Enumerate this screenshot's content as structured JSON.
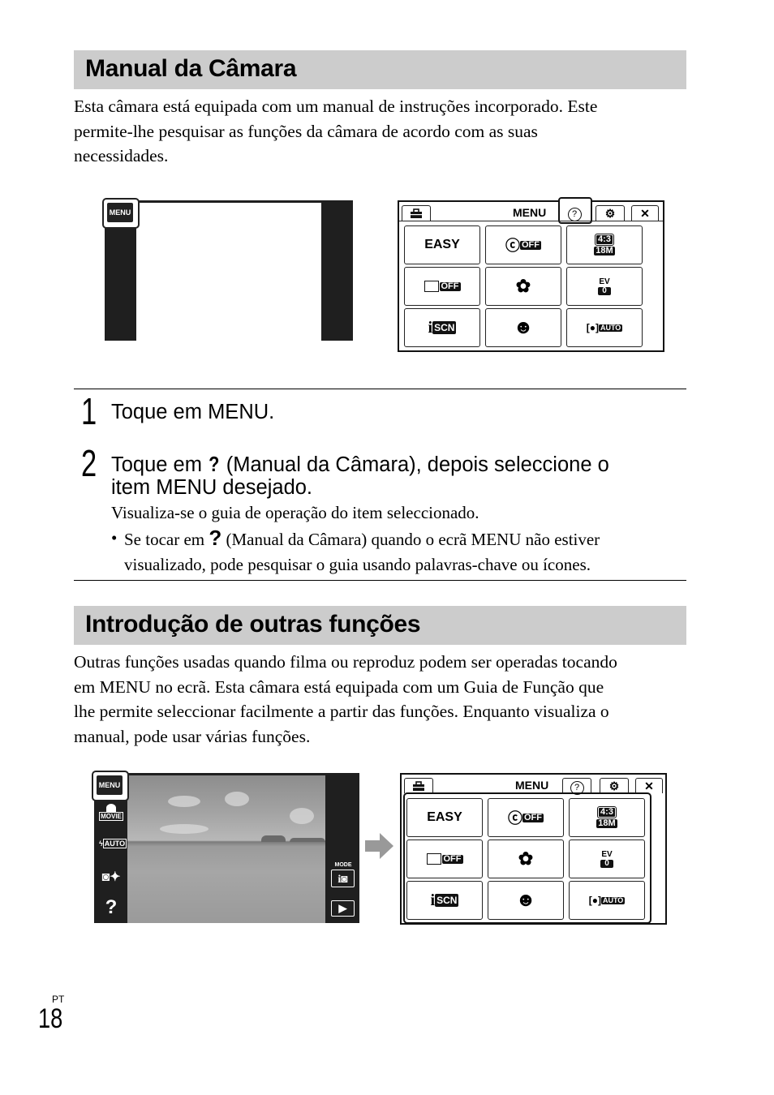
{
  "section1": {
    "title": "Manual da Câmara",
    "paragraph_lines": [
      "Esta câmara está equipada com um manual de instruções incorporado. Este",
      "permite-lhe pesquisar as funções da câmara de acordo com as suas",
      "necessidades."
    ]
  },
  "camera_ui": {
    "menu_button": "MENU",
    "menu_title": "MENU",
    "tabs": {
      "toolbox": "toolbox-icon",
      "help": "?",
      "settings": "⚙",
      "close": "✕"
    },
    "grid": {
      "easy": "EASY",
      "self_timer_off": "OFF",
      "aspect": "4:3",
      "size": "18M",
      "burst_off": "OFF",
      "macro": "macro-icon",
      "ev_label": "EV",
      "ev_value": "0",
      "iscn_i": "i",
      "iscn": "SCN",
      "smile": "smile-icon",
      "face_auto": "AUTO"
    },
    "side_icons": {
      "movie": "MOVIE",
      "flash_auto": "AUTO",
      "mode_label": "MODE",
      "mode_i": "i",
      "help": "?"
    }
  },
  "steps": [
    {
      "number": "1",
      "text": "Toque em MENU."
    },
    {
      "number": "2",
      "text_before": "Toque em",
      "icon": "?",
      "text_after": "(Manual da Câmara), depois seleccione o",
      "text_line2": "item MENU desejado."
    }
  ],
  "notes": {
    "result": "Visualiza-se o guia de operação do item seleccionado.",
    "bullet": "•",
    "bullet_before": "Se tocar em",
    "bullet_icon": "?",
    "bullet_after": "(Manual da Câmara) quando o ecrã MENU não estiver",
    "bullet_line2": "visualizado, pode pesquisar o guia usando palavras-chave ou ícones."
  },
  "section2": {
    "title": "Introdução de outras funções",
    "paragraph_lines": [
      "Outras funções usadas quando filma ou reproduz podem ser operadas tocando",
      "em MENU no ecrã. Esta câmara está equipada com um Guia de Função que",
      "lhe permite seleccionar facilmente a partir das funções. Enquanto visualiza o",
      "manual, pode usar várias funções."
    ]
  },
  "footer": {
    "language": "PT",
    "page_number": "18"
  },
  "colors": {
    "section_bar": "#cccccc",
    "screen_dark": "#1f1f1f",
    "arrow": "#999999"
  }
}
